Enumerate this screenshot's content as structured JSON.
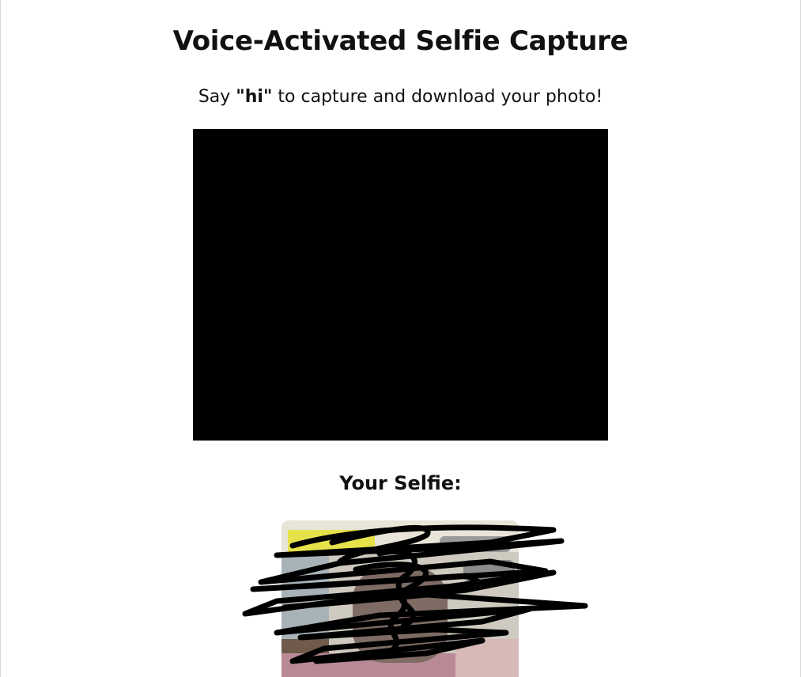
{
  "page": {
    "title": "Voice-Activated Selfie Capture",
    "instruction_prefix": "Say ",
    "instruction_keyword": "\"hi\"",
    "instruction_suffix": " to capture and download your photo!",
    "selfie_heading": "Your Selfie:"
  },
  "colors": {
    "video_background": "#000000",
    "page_background": "#ffffff"
  }
}
